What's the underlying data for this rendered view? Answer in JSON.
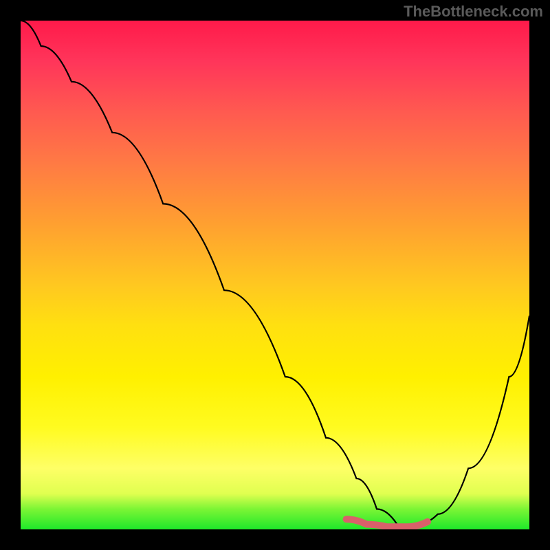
{
  "watermark": "TheBottleneck.com",
  "chart_data": {
    "type": "line",
    "title": "",
    "xlabel": "",
    "ylabel": "",
    "xlim": [
      0,
      100
    ],
    "ylim": [
      0,
      100
    ],
    "background_gradient": {
      "top": "#ff1a4a",
      "middle": "#ffe010",
      "bottom": "#1ee82a"
    },
    "series": [
      {
        "name": "bottleneck-curve",
        "color": "#000000",
        "x": [
          0,
          4,
          10,
          18,
          28,
          40,
          52,
          60,
          66,
          70,
          74,
          78,
          82,
          88,
          96,
          100
        ],
        "y": [
          100,
          95,
          88,
          78,
          64,
          47,
          30,
          18,
          10,
          4,
          1,
          1,
          3,
          12,
          30,
          42
        ]
      }
    ],
    "highlight_segment": {
      "name": "optimal-range",
      "color": "#d9606a",
      "x": [
        64,
        68,
        72,
        76,
        80
      ],
      "y": [
        2,
        1,
        0.5,
        0.5,
        1.5
      ]
    }
  }
}
